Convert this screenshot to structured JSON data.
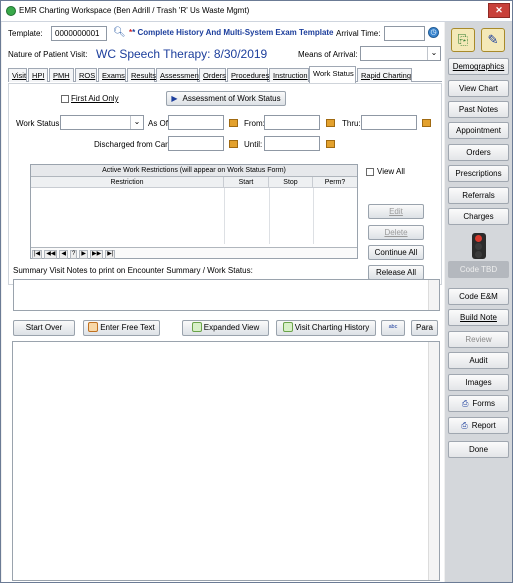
{
  "window": {
    "title": "EMR Charting Workspace (Ben Adrill / Trash 'R' Us Waste Mgmt)"
  },
  "header": {
    "template_label": "Template:",
    "template_value": "0000000001",
    "template_name": "* Complete History And Multi-System Exam Template",
    "arrival_time_label": "Arrival Time:",
    "arrival_time_value": "",
    "nature_label": "Nature of Patient Visit:",
    "nature_value": "WC Speech Therapy: 8/30/2019",
    "means_label": "Means of Arrival:",
    "means_value": ""
  },
  "tabs": [
    "Visit",
    "HPI",
    "PMH",
    "ROS",
    "Exams",
    "Results",
    "Assessment",
    "Orders",
    "Procedures",
    "Instruction",
    "Work Status",
    "Rapid Charting"
  ],
  "active_tab": "Work Status",
  "work_status": {
    "first_aid_label": "First Aid Only",
    "assessment_button": "Assessment of Work Status",
    "work_status_label": "Work Status:",
    "work_status_value": "",
    "as_of_label": "As Of:",
    "as_of_value": "",
    "from_label": "From:",
    "from_value": "",
    "thru_label": "Thru:",
    "thru_value": "",
    "discharged_label": "Discharged from Care:",
    "discharged_value": "",
    "until_label": "Until:",
    "until_value": ""
  },
  "restrictions": {
    "title": "Active Work Restrictions (will appear on Work Status Form)",
    "columns": [
      "Restriction",
      "Start",
      "Stop",
      "Perm?"
    ],
    "rows": [],
    "nav_buttons": [
      "|◀",
      "◀◀",
      "◀",
      "?",
      "▶",
      "▶▶",
      "▶|"
    ],
    "view_all_label": "View All",
    "edit_button": "Edit",
    "delete_button": "Delete",
    "continue_all_button": "Continue All",
    "release_all_button": "Release All"
  },
  "summary": {
    "label": "Summary Visit Notes to print on Encounter Summary / Work Status:",
    "value": ""
  },
  "toolbar": {
    "start_over": "Start Over",
    "enter_free_text": "Enter Free Text",
    "expanded_view": "Expanded View",
    "visit_charting_history": "Visit Charting History",
    "para": "Para"
  },
  "editor": {
    "content": ""
  },
  "sidebar": {
    "buttons": [
      "Demographics",
      "View Chart",
      "Past Notes",
      "Appointment",
      "Orders",
      "Prescriptions",
      "Referrals",
      "Charges"
    ],
    "code_tbd": "Code TBD",
    "buttons2": [
      "Code E&M",
      "Build Note",
      "Review",
      "Audit",
      "Images",
      "Forms",
      "Report",
      "Done"
    ]
  }
}
